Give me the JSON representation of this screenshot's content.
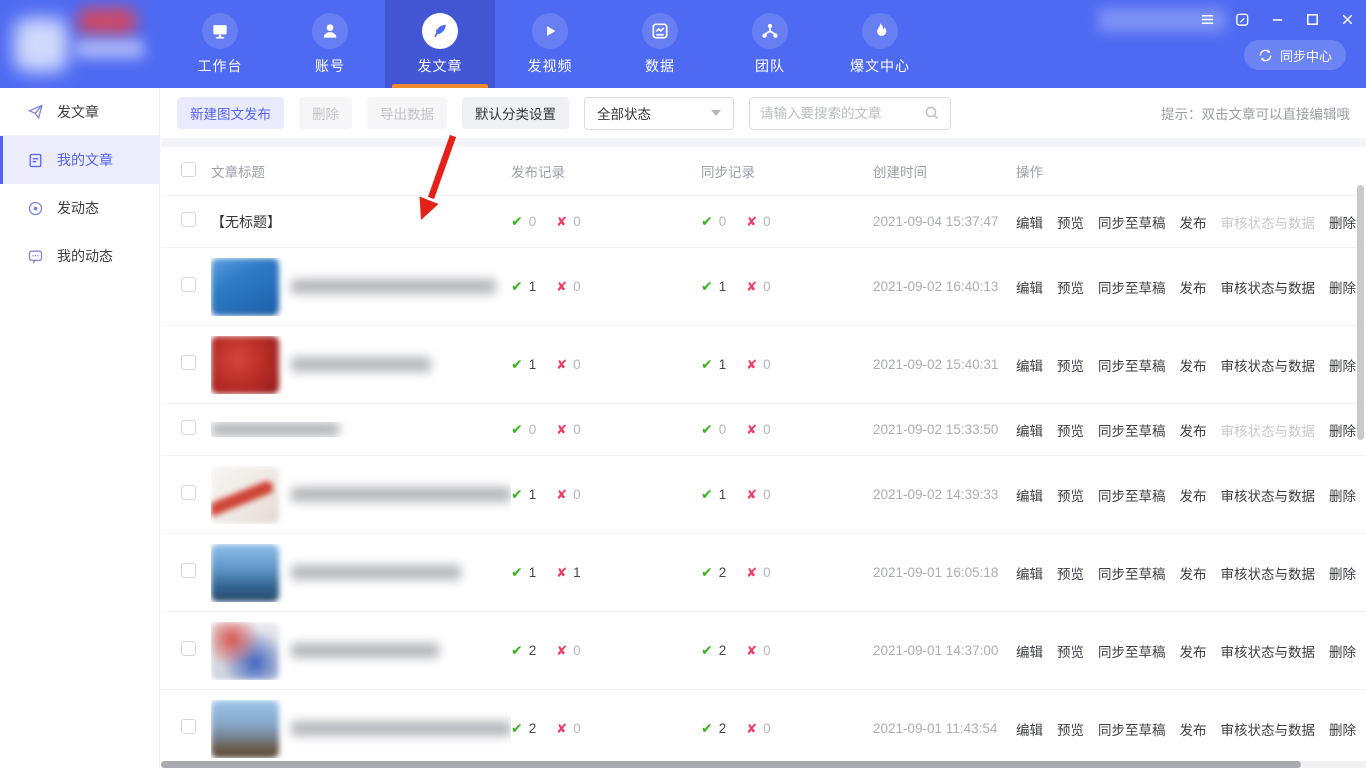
{
  "header": {
    "tabs": [
      {
        "label": "工作台",
        "icon": "monitor",
        "selected": false
      },
      {
        "label": "账号",
        "icon": "user",
        "selected": false
      },
      {
        "label": "发文章",
        "icon": "feather",
        "selected": true
      },
      {
        "label": "发视频",
        "icon": "play",
        "selected": false
      },
      {
        "label": "数据",
        "icon": "chart",
        "selected": false
      },
      {
        "label": "团队",
        "icon": "team",
        "selected": false
      },
      {
        "label": "爆文中心",
        "icon": "flame",
        "selected": false
      }
    ],
    "sync_button_label": "同步中心"
  },
  "sidebar": {
    "items": [
      {
        "label": "发文章",
        "icon": "paper-plane",
        "selected": false
      },
      {
        "label": "我的文章",
        "icon": "document",
        "selected": true
      },
      {
        "label": "发动态",
        "icon": "disc",
        "selected": false
      },
      {
        "label": "我的动态",
        "icon": "chat",
        "selected": false
      }
    ]
  },
  "toolbar": {
    "new_button": "新建图文发布",
    "delete_button": "删除",
    "export_button": "导出数据",
    "category_button": "默认分类设置",
    "status_filter_value": "全部状态",
    "search_placeholder": "请输入要搜索的文章",
    "hint": "提示：双击文章可以直接编辑哦"
  },
  "icons": {
    "check_glyph": "✔",
    "cross_glyph": "✘"
  },
  "table": {
    "columns": [
      "文章标题",
      "发布记录",
      "同步记录",
      "创建时间",
      "操作"
    ],
    "actions": [
      "编辑",
      "预览",
      "同步至草稿",
      "发布",
      "审核状态与数据",
      "删除"
    ],
    "rows": [
      {
        "title": "【无标题】",
        "blurred": false,
        "thumb": null,
        "blur_width": 0,
        "publish_ok": "0",
        "publish_fail": "0",
        "sync_ok": "0",
        "sync_fail": "0",
        "created": "2021-09-04 15:37:47",
        "review_enabled": false
      },
      {
        "title": "",
        "blurred": true,
        "thumb": "blue-app",
        "blur_width": 205,
        "publish_ok": "1",
        "publish_fail": "0",
        "sync_ok": "1",
        "sync_fail": "0",
        "created": "2021-09-02 16:40:13",
        "review_enabled": true
      },
      {
        "title": "",
        "blurred": true,
        "thumb": "red",
        "blur_width": 140,
        "publish_ok": "1",
        "publish_fail": "0",
        "sync_ok": "1",
        "sync_fail": "0",
        "created": "2021-09-02 15:40:31",
        "review_enabled": true
      },
      {
        "title": "",
        "blurred": true,
        "thumb": null,
        "blur_width": 128,
        "publish_ok": "0",
        "publish_fail": "0",
        "sync_ok": "0",
        "sync_fail": "0",
        "created": "2021-09-02 15:33:50",
        "review_enabled": false
      },
      {
        "title": "",
        "blurred": true,
        "thumb": "white-swoosh",
        "blur_width": 220,
        "publish_ok": "1",
        "publish_fail": "0",
        "sync_ok": "1",
        "sync_fail": "0",
        "created": "2021-09-02 14:39:33",
        "review_enabled": true
      },
      {
        "title": "",
        "blurred": true,
        "thumb": "sky-photo",
        "blur_width": 170,
        "publish_ok": "1",
        "publish_fail": "1",
        "sync_ok": "2",
        "sync_fail": "0",
        "created": "2021-09-01 16:05:18",
        "review_enabled": true
      },
      {
        "title": "",
        "blurred": true,
        "thumb": "multi",
        "blur_width": 148,
        "publish_ok": "2",
        "publish_fail": "0",
        "sync_ok": "2",
        "sync_fail": "0",
        "created": "2021-09-01 14:37:00",
        "review_enabled": true
      },
      {
        "title": "",
        "blurred": true,
        "thumb": "landscape",
        "blur_width": 228,
        "publish_ok": "2",
        "publish_fail": "0",
        "sync_ok": "2",
        "sync_fail": "0",
        "created": "2021-09-01 11:43:54",
        "review_enabled": true
      }
    ]
  },
  "colors": {
    "header_bg": "#4e6af2",
    "header_tab_selected_bg": "#4356d4",
    "tab_underline": "#f08a2e",
    "accent": "#5663ee",
    "accent_light_bg": "#e9ebfd",
    "success_check": "#39b121",
    "fail_cross": "#ed4066",
    "annotation_arrow": "#e32119"
  }
}
